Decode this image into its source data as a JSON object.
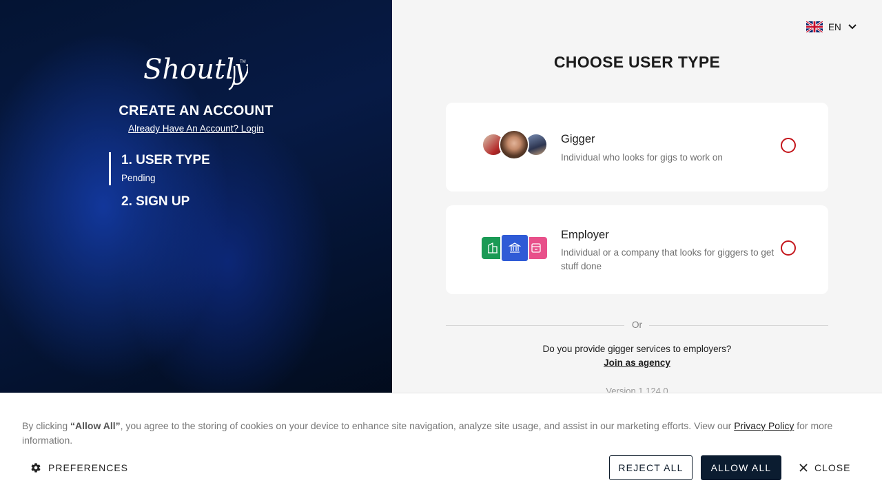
{
  "brand": {
    "logo_text": "Shoutly"
  },
  "signup": {
    "title": "CREATE AN ACCOUNT",
    "login_link": "Already Have An Account? Login",
    "steps": [
      {
        "label": "1. USER TYPE",
        "status": "Pending",
        "active": true
      },
      {
        "label": "2. SIGN UP"
      }
    ]
  },
  "language": {
    "code": "EN",
    "flag_icon": "uk-flag-icon"
  },
  "main": {
    "title": "CHOOSE USER TYPE",
    "options": [
      {
        "title": "Gigger",
        "description": "Individual who looks for gigs to work on",
        "icon": "people-avatars-icon",
        "selected": false
      },
      {
        "title": "Employer",
        "description": "Individual or a company that looks for giggers to get stuff done",
        "icon": "buildings-icon",
        "selected": false
      }
    ],
    "divider_text": "Or",
    "agency_question": "Do you provide gigger services to employers?",
    "agency_link": "Join as agency",
    "version": "Version 1.124.0"
  },
  "cookie_banner": {
    "text_before": "By clicking ",
    "bold_text": "“Allow All”",
    "text_middle": ", you agree to the storing of cookies on your device to enhance site navigation, analyze site usage, and assist in our marketing efforts. View our ",
    "privacy_link": "Privacy Policy",
    "text_after": " for more information.",
    "preferences_label": "PREFERENCES",
    "reject_label": "REJECT ALL",
    "allow_label": "ALLOW ALL",
    "close_label": "CLOSE"
  },
  "colors": {
    "accent_red": "#c4161c",
    "dark_navy": "#0b1c30",
    "employer_green": "#1a9a55",
    "employer_blue": "#2f5bd6",
    "employer_pink": "#e8508a"
  }
}
